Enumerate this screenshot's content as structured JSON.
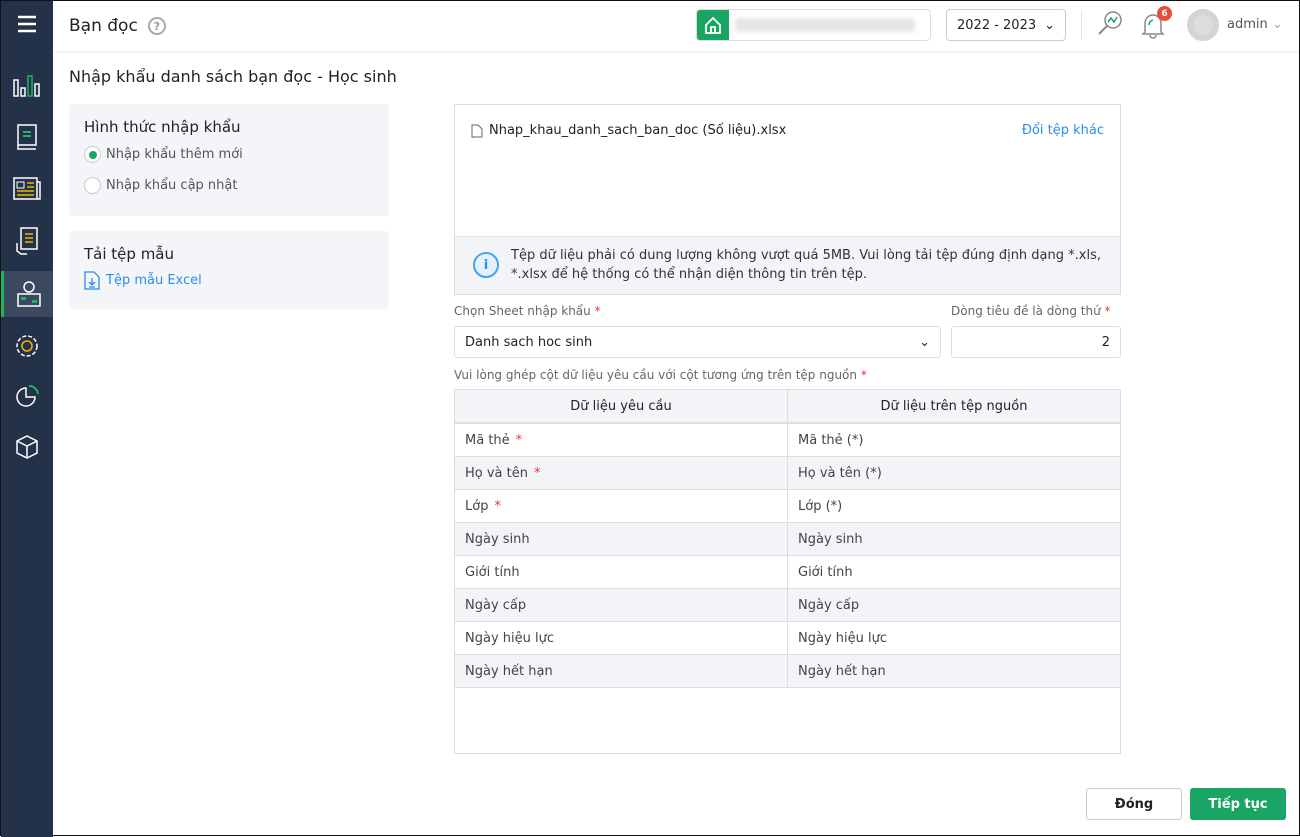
{
  "header": {
    "title": "Bạn đọc",
    "help": "?",
    "year": "2022 - 2023",
    "notifications": "6",
    "user": "admin"
  },
  "page_title": "Nhập khẩu danh sách bạn đọc - Học sinh",
  "import_type": {
    "title": "Hình thức nhập khẩu",
    "options": [
      {
        "label": "Nhập khẩu thêm mới",
        "selected": true
      },
      {
        "label": "Nhập khẩu cập nhật",
        "selected": false
      }
    ]
  },
  "template": {
    "title": "Tải tệp mẫu",
    "link": "Tệp mẫu Excel"
  },
  "file": {
    "name": "Nhap_khau_danh_sach_ban_doc (Số liệu).xlsx",
    "change": "Đổi tệp khác",
    "info": "Tệp dữ liệu phải có dung lượng không vượt quá 5MB. Vui lòng tải tệp đúng định dạng *.xls, *.xlsx để hệ thống có thể nhận diện thông tin trên tệp."
  },
  "form": {
    "sheet_label": "Chọn Sheet nhập khẩu",
    "sheet_value": "Danh sach hoc sinh",
    "header_row_label": "Dòng tiêu đề là dòng thứ",
    "header_row_value": "2",
    "mapping_label": "Vui lòng ghép cột dữ liệu yêu cầu với cột tương ứng trên tệp nguồn",
    "required": "*"
  },
  "table": {
    "headers": [
      "Dữ liệu yêu cầu",
      "Dữ liệu trên tệp nguồn"
    ],
    "rows": [
      [
        "Mã thẻ",
        "Mã thẻ (*)",
        true
      ],
      [
        "Họ và tên",
        "Họ và tên (*)",
        true
      ],
      [
        "Lớp",
        "Lớp (*)",
        true
      ],
      [
        "Ngày sinh",
        "Ngày sinh",
        false
      ],
      [
        "Giới tính",
        "Giới tính",
        false
      ],
      [
        "Ngày cấp",
        "Ngày cấp",
        false
      ],
      [
        "Ngày hiệu lực",
        "Ngày hiệu lực",
        false
      ],
      [
        "Ngày hết hạn",
        "Ngày hết hạn",
        false
      ]
    ]
  },
  "buttons": {
    "close": "Đóng",
    "next": "Tiếp tục"
  },
  "colors": {
    "sidebar": "#243249",
    "accent": "#1aa564",
    "link": "#2b8ee8"
  }
}
